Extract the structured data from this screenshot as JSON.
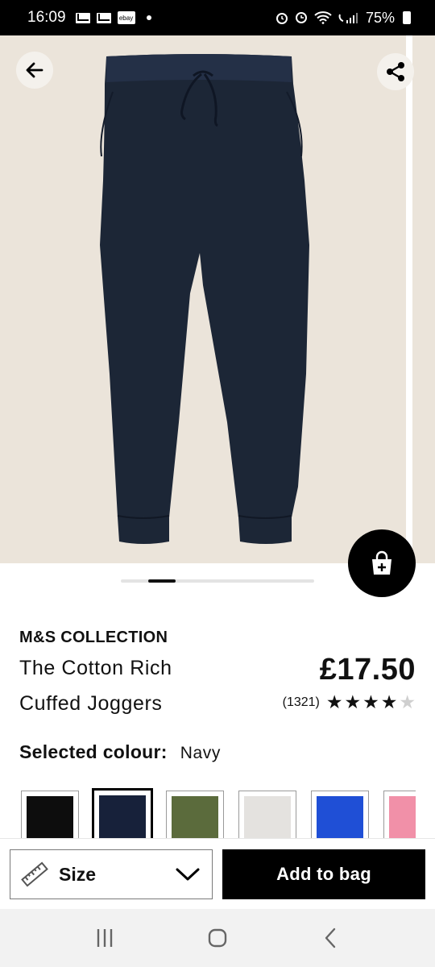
{
  "status_bar": {
    "time": "16:09",
    "battery": "75%",
    "ebay_badge": "ebay"
  },
  "product": {
    "brand": "M&S COLLECTION",
    "title_line_1": "The Cotton Rich",
    "title_line_2": "Cuffed Joggers",
    "price": "£17.50",
    "review_count": "(1321)",
    "rating": 4,
    "rating_max": 5,
    "selected_colour_label": "Selected colour:",
    "selected_colour_value": "Navy",
    "image_color": "#1c2636",
    "image_bg": "#ebe4da"
  },
  "carousel": {
    "slide_count": 7,
    "active_index": 1
  },
  "swatches": [
    {
      "name": "Black",
      "color": "#0d0d0d",
      "selected": false
    },
    {
      "name": "Navy",
      "color": "#17213a",
      "selected": true
    },
    {
      "name": "Khaki",
      "color": "#5b6b3c",
      "selected": false
    },
    {
      "name": "Grey Marl",
      "color": "#e4e2df",
      "selected": false
    },
    {
      "name": "Bright Blue",
      "color": "#1f4fd6",
      "selected": false
    },
    {
      "name": "Pink",
      "color": "#f190a8",
      "selected": false
    }
  ],
  "actions": {
    "size_label": "Size",
    "add_to_bag_label": "Add to bag"
  },
  "icons": {
    "back": "arrow-left-icon",
    "share": "share-icon",
    "add_to_bag_fab": "bag-plus-icon",
    "size": "ruler-icon",
    "size_dropdown": "chevron-down-icon"
  }
}
